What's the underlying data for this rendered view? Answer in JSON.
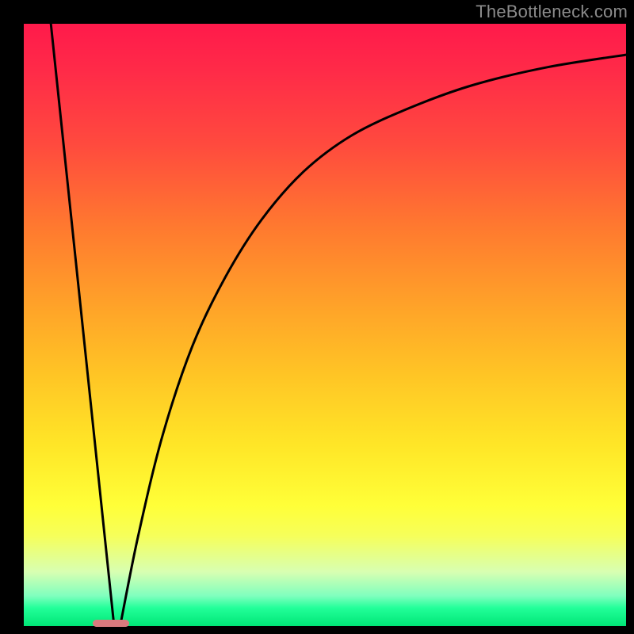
{
  "watermark": "TheBottleneck.com",
  "marker": {
    "x_frac": 0.145,
    "width_frac": 0.06
  },
  "chart_data": {
    "type": "line",
    "title": "",
    "xlabel": "",
    "ylabel": "",
    "xlim": [
      0,
      1
    ],
    "ylim": [
      0,
      1
    ],
    "series": [
      {
        "name": "left-line",
        "x": [
          0.045,
          0.15
        ],
        "y": [
          1.0,
          0.0
        ]
      },
      {
        "name": "right-curve",
        "x": [
          0.16,
          0.19,
          0.23,
          0.28,
          0.335,
          0.395,
          0.465,
          0.545,
          0.64,
          0.745,
          0.87,
          1.01
        ],
        "y": [
          0.0,
          0.15,
          0.315,
          0.465,
          0.58,
          0.675,
          0.755,
          0.815,
          0.86,
          0.898,
          0.928,
          0.95
        ]
      }
    ],
    "grid": false,
    "legend": false
  }
}
